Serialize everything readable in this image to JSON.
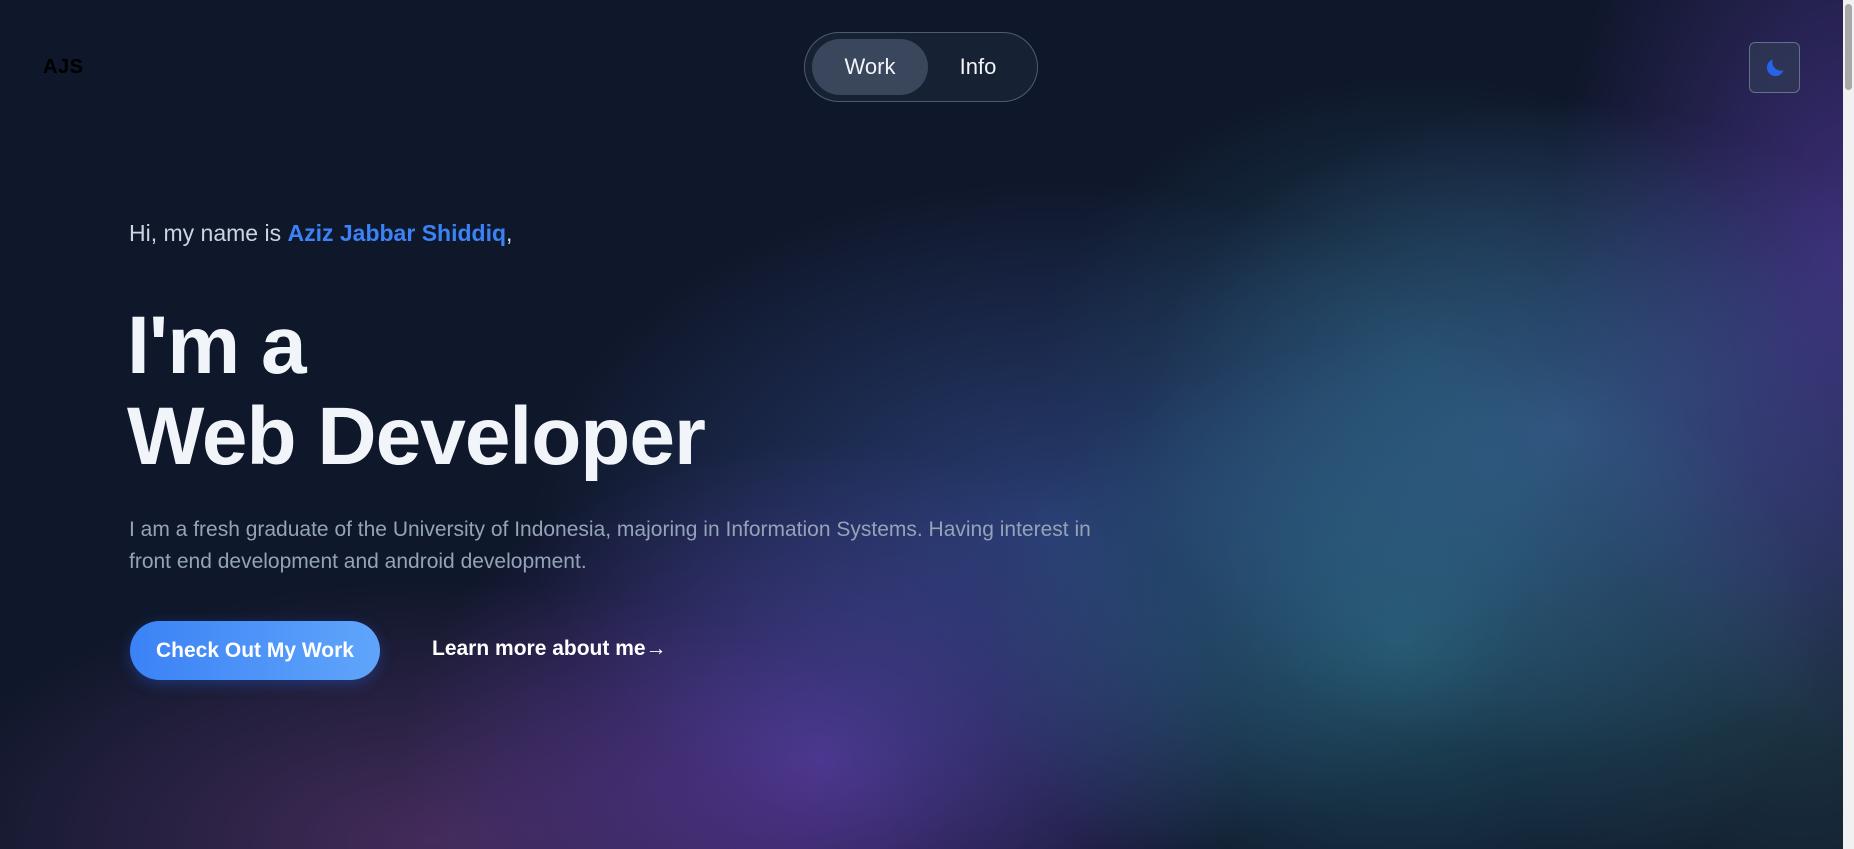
{
  "header": {
    "logo": "AJS",
    "nav": [
      {
        "label": "Work",
        "active": true
      },
      {
        "label": "Info",
        "active": false
      }
    ],
    "theme_toggle_icon": "moon-icon"
  },
  "hero": {
    "greeting_prefix": "Hi, my name is ",
    "name": "Aziz Jabbar Shiddiq",
    "greeting_suffix": ",",
    "headline_line1": "I'm a",
    "headline_line2": "Web Developer",
    "description": "I am a fresh graduate of the University of Indonesia, majoring in Information Systems. Having interest in front end development and android development.",
    "cta_label": "Check Out My Work",
    "learn_more_label": "Learn more about me→"
  },
  "colors": {
    "accent": "#3b82f6",
    "background": "#0f172a",
    "heading": "#f1f5f9",
    "body_text": "#94a3b8"
  }
}
